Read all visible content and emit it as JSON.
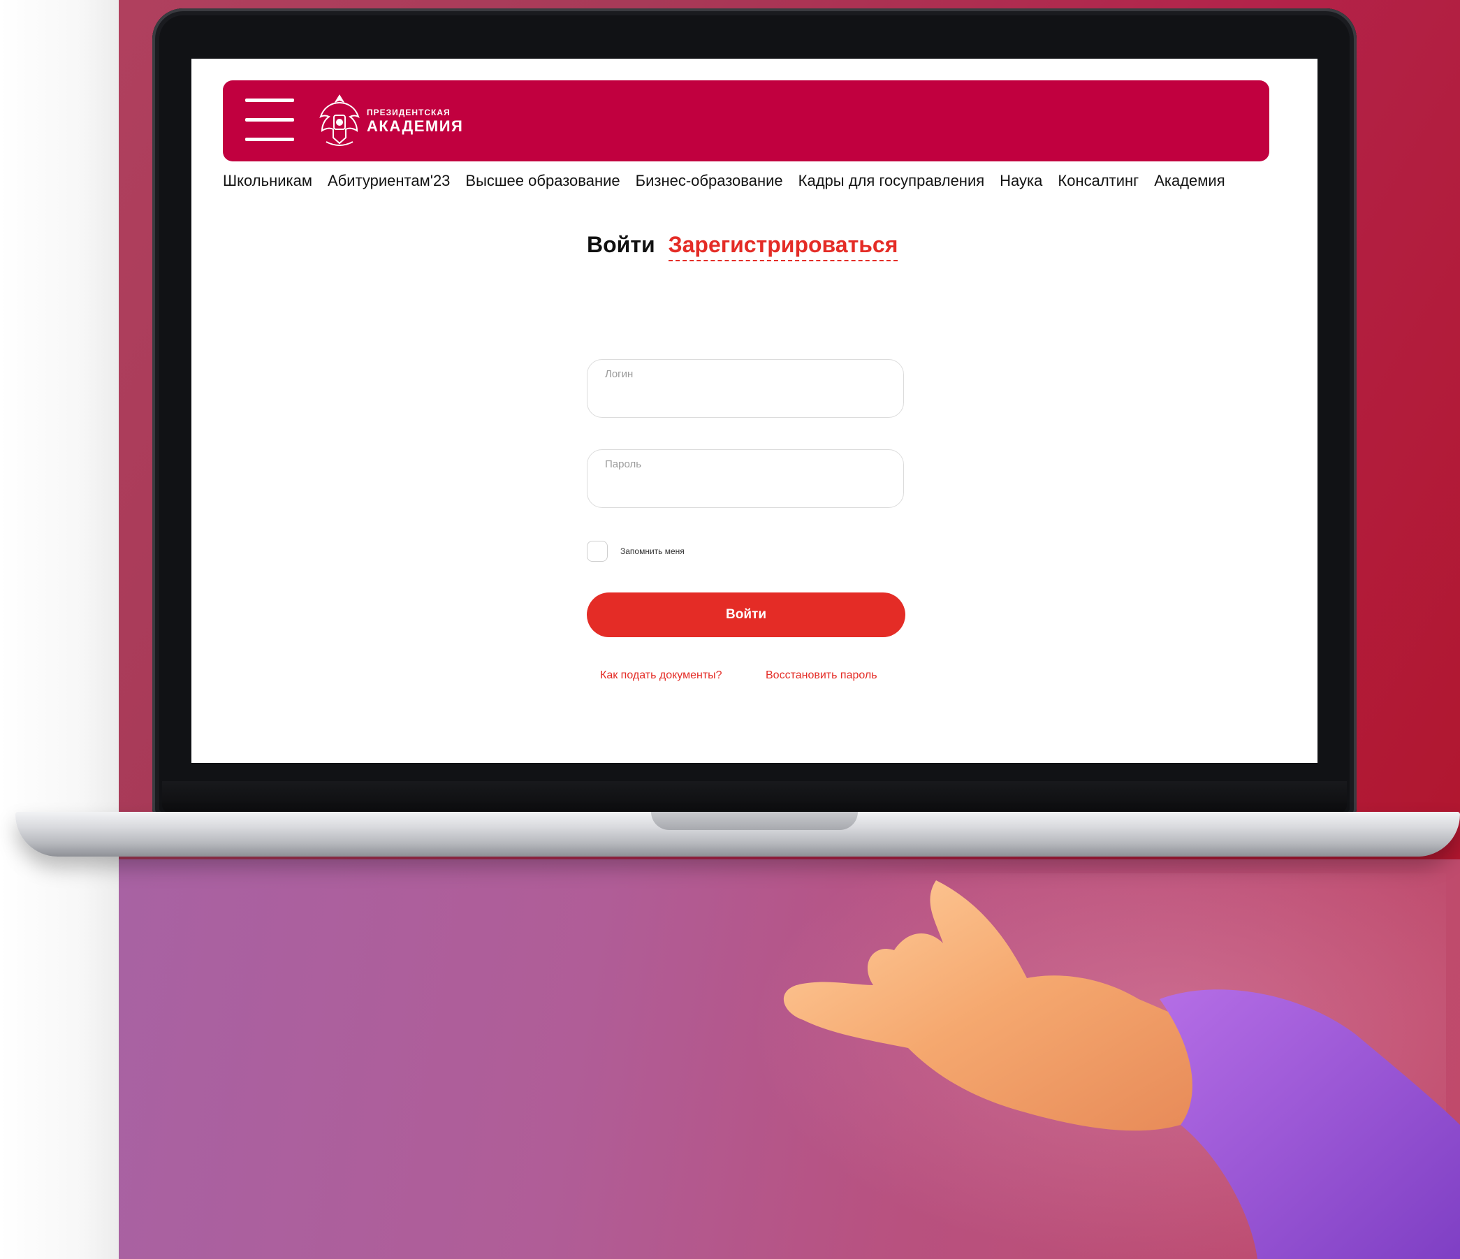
{
  "header": {
    "logo_small": "ПРЕЗИДЕНТСКАЯ",
    "logo_big": "АКАДЕМИЯ"
  },
  "nav": {
    "items": [
      {
        "label": "Школьникам"
      },
      {
        "label": "Абитуриентам'23"
      },
      {
        "label": "Высшее образование"
      },
      {
        "label": "Бизнес-образование"
      },
      {
        "label": "Кадры для госуправления"
      },
      {
        "label": "Наука"
      },
      {
        "label": "Консалтинг"
      },
      {
        "label": "Академия"
      }
    ]
  },
  "auth": {
    "tab_login": "Войти",
    "tab_register": "Зарегистрироваться",
    "login_label": "Логин",
    "login_value": "",
    "password_label": "Пароль",
    "password_value": "",
    "remember_label": "Запомнить меня",
    "remember_checked": false,
    "submit_label": "Войти",
    "link_docs": "Как подать документы?",
    "link_restore": "Восстановить пароль"
  },
  "colors": {
    "brand": "#c1003f",
    "accent": "#e42c26"
  }
}
